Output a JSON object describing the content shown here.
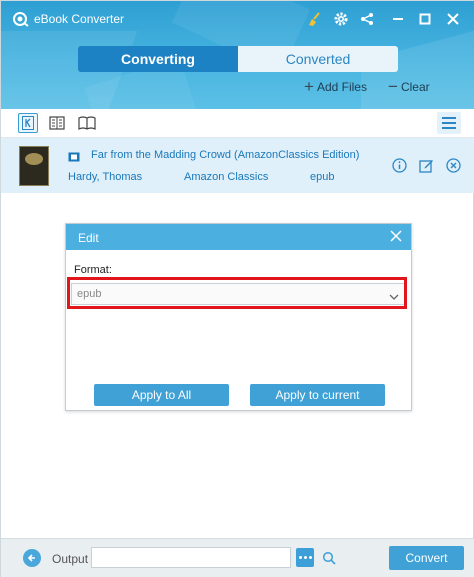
{
  "window": {
    "title": "eBook Converter",
    "accent": "#47b4e0",
    "brand": "#1c82c4"
  },
  "titlebar_icons": [
    "broom-icon",
    "gear-icon",
    "share-icon",
    "minimize-icon",
    "maximize-icon",
    "close-icon"
  ],
  "tabs": [
    {
      "label": "Converting",
      "active": true
    },
    {
      "label": "Converted",
      "active": false
    }
  ],
  "actions": {
    "add_files": "Add Files",
    "clear": "Clear"
  },
  "view_modes": [
    "kindle-icon",
    "list-view-icon",
    "book-view-icon"
  ],
  "book": {
    "title": "Far from the Madding Crowd (AmazonClassics Edition)",
    "author": "Hardy, Thomas",
    "publisher": "Amazon Classics",
    "format": "epub"
  },
  "edit_dialog": {
    "title": "Edit",
    "format_label": "Format:",
    "format_value": "epub",
    "apply_all": "Apply to All",
    "apply_current": "Apply to current",
    "highlight_color": "#e2141c"
  },
  "footer": {
    "output_label": "Output",
    "output_value": "",
    "convert": "Convert"
  }
}
